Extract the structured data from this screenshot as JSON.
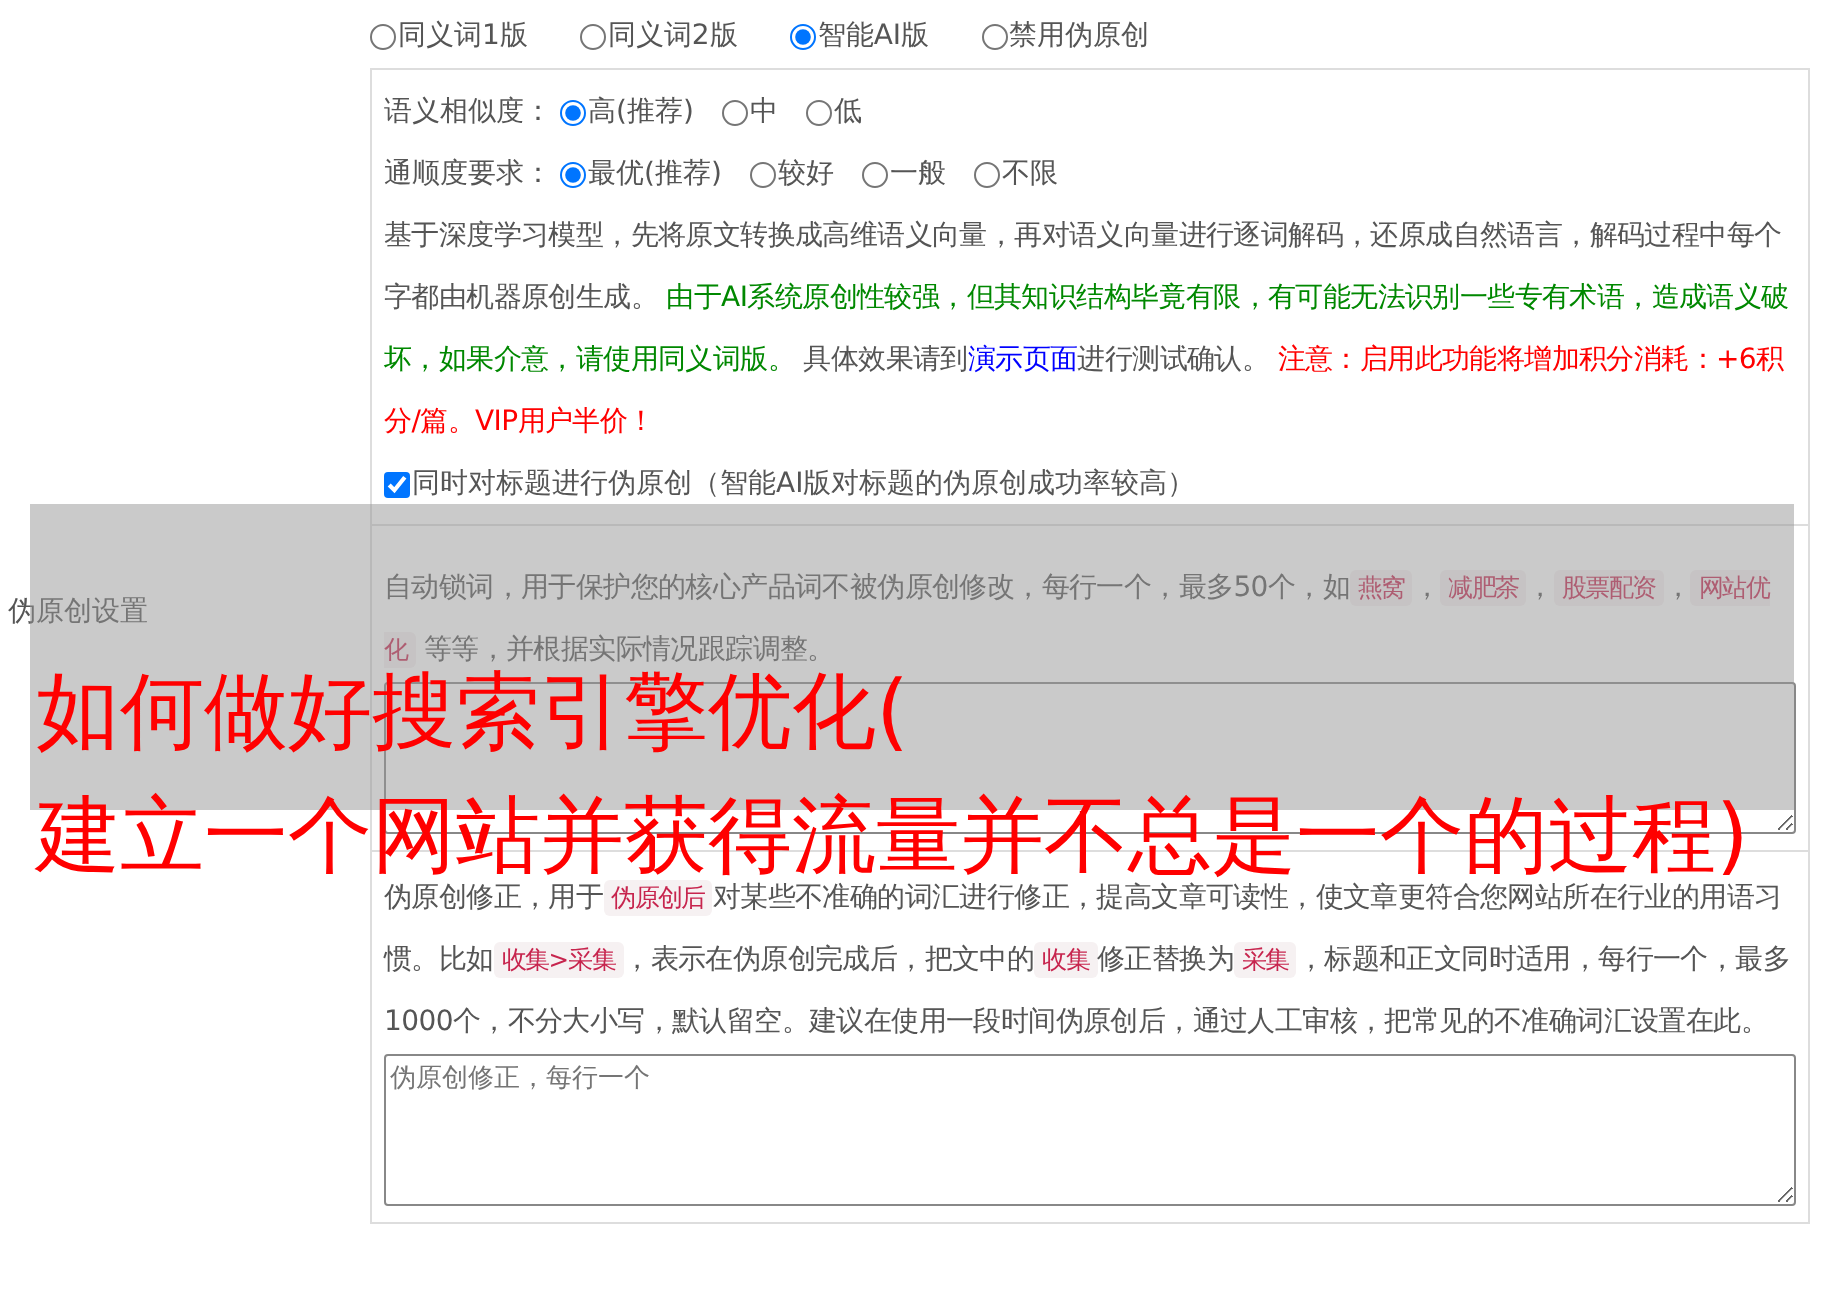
{
  "mode_options": [
    {
      "label": "同义词1版",
      "selected": false
    },
    {
      "label": "同义词2版",
      "selected": false
    },
    {
      "label": "智能AI版",
      "selected": true
    },
    {
      "label": "禁用伪原创",
      "selected": false
    }
  ],
  "ai_settings": {
    "similarity": {
      "label": "语义相似度：",
      "options": [
        {
          "label": "高(推荐)",
          "selected": true
        },
        {
          "label": "中",
          "selected": false
        },
        {
          "label": "低",
          "selected": false
        }
      ]
    },
    "fluency": {
      "label": "通顺度要求：",
      "options": [
        {
          "label": "最优(推荐)",
          "selected": true
        },
        {
          "label": "较好",
          "selected": false
        },
        {
          "label": "一般",
          "selected": false
        },
        {
          "label": "不限",
          "selected": false
        }
      ]
    },
    "description": [
      {
        "kind": "plain",
        "text": "基于深度学习模型，先将原文转换成高维语义向量，再对语义向量进行逐词解码，还原成自然语言，解码过程中每个字都由机器原创生成。 "
      },
      {
        "kind": "note",
        "text": "由于AI系统原创性较强，但其知识结构毕竟有限，有可能无法识别一些专有术语，造成语义破坏，如果介意，请使用同义词版。"
      },
      {
        "kind": "plain",
        "text": " 具体效果请到"
      },
      {
        "kind": "link",
        "text": "演示页面"
      },
      {
        "kind": "plain",
        "text": "进行测试确认。 "
      },
      {
        "kind": "warning",
        "text": "注意：启用此功能将增加积分消耗：+6积分/篇。VIP用户半价！"
      }
    ],
    "title_option": {
      "label": "同时对标题进行伪原创（智能AI版对标题的伪原创成功率较高）",
      "checked": true
    }
  },
  "side_label": "伪原创设置",
  "lock_words": {
    "description": [
      {
        "kind": "plain",
        "text": "自动锁词，用于保护您的核心产品词不被伪原创修改，每行一个，最多50个，如"
      },
      {
        "kind": "tag",
        "text": "燕窝"
      },
      {
        "kind": "plain",
        "text": "，"
      },
      {
        "kind": "tag",
        "text": "减肥茶"
      },
      {
        "kind": "plain",
        "text": "，"
      },
      {
        "kind": "tag",
        "text": "股票配资"
      },
      {
        "kind": "plain",
        "text": "，"
      },
      {
        "kind": "tag",
        "text": "网站优化"
      },
      {
        "kind": "plain",
        "text": " 等等，并根据实际情况跟踪调整。"
      }
    ]
  },
  "correction": {
    "description": [
      {
        "kind": "plain",
        "text": "伪原创修正，用于"
      },
      {
        "kind": "tag",
        "text": "伪原创后"
      },
      {
        "kind": "plain",
        "text": "对某些不准确的词汇进行修正，提高文章可读性，使文章更符合您网站所在行业的用语习惯。比如"
      },
      {
        "kind": "tag",
        "text": "收集>采集"
      },
      {
        "kind": "plain",
        "text": "，表示在伪原创完成后，把文中的"
      },
      {
        "kind": "tag",
        "text": "收集"
      },
      {
        "kind": "plain",
        "text": "修正替换为"
      },
      {
        "kind": "tag",
        "text": "采集"
      },
      {
        "kind": "plain",
        "text": "，标题和正文同时适用，每行一个，最多1000个，不分大小写，默认留空。建议在使用一段时间伪原创后，通过人工审核，把常见的不准确词汇设置在此。"
      }
    ],
    "placeholder": "伪原创修正，每行一个"
  },
  "overlay_title": {
    "lines": [
      "如何做好搜索引擎优化(",
      "建立一个网站并获得流量并不总是一个的过程)"
    ]
  }
}
